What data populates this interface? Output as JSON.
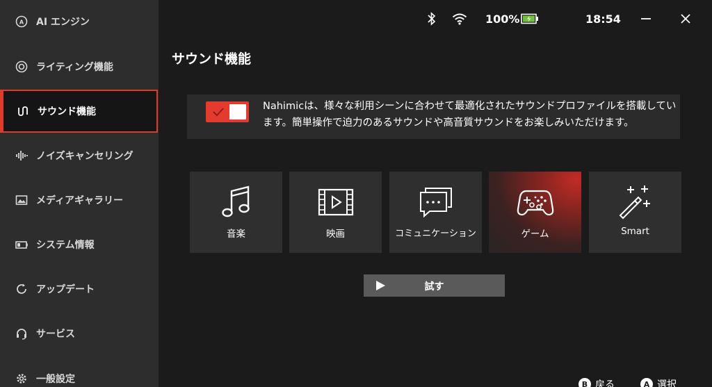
{
  "sidebar": {
    "items": [
      {
        "label": "AI エンジン",
        "icon": "ai-icon"
      },
      {
        "label": "ライティング機能",
        "icon": "lighting-icon"
      },
      {
        "label": "サウンド機能",
        "icon": "sound-wave-icon",
        "active": true
      },
      {
        "label": "ノイズキャンセリング",
        "icon": "noise-bars-icon"
      },
      {
        "label": "メディアギャラリー",
        "icon": "image-icon"
      },
      {
        "label": "システム情報",
        "icon": "battery-system-icon"
      },
      {
        "label": "アップデート",
        "icon": "update-icon"
      },
      {
        "label": "サービス",
        "icon": "headset-icon"
      },
      {
        "label": "一般設定",
        "icon": "gear-icon"
      }
    ]
  },
  "status": {
    "battery_percent": "100%",
    "time": "18:54"
  },
  "page": {
    "title": "サウンド機能",
    "description": "Nahimicは、様々な利用シーンに合わせて最適化されたサウンドプロファイルを搭載しています。簡単操作で迫力のあるサウンドや高音質サウンドをお楽しみいただけます。",
    "toggle_on": true
  },
  "profiles": [
    {
      "label": "音楽",
      "icon": "music-note-icon"
    },
    {
      "label": "映画",
      "icon": "film-icon"
    },
    {
      "label": "コミュニケーション",
      "icon": "chat-icon"
    },
    {
      "label": "ゲーム",
      "icon": "gamepad-icon",
      "selected": true
    },
    {
      "label": "Smart",
      "icon": "magic-wand-icon"
    }
  ],
  "try_button": {
    "label": "試す"
  },
  "footer": {
    "back_key": "B",
    "back_label": "戻る",
    "select_key": "A",
    "select_label": "選択"
  },
  "colors": {
    "accent": "#e03a2c",
    "sidebar_bg": "#2d2d2d",
    "main_bg": "#1b1b1b"
  }
}
